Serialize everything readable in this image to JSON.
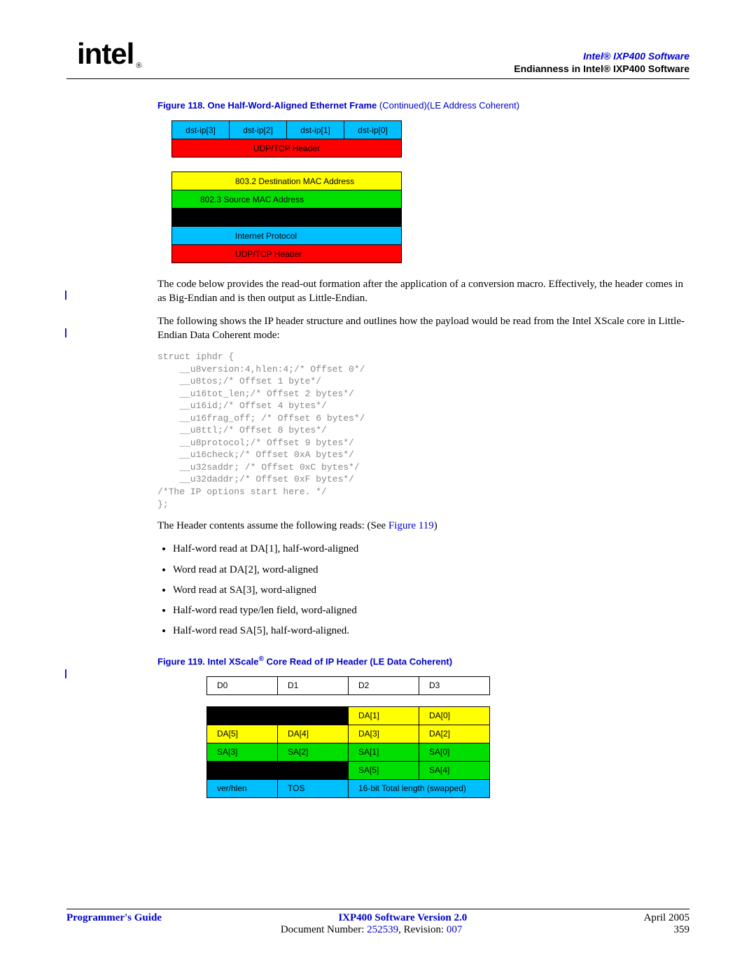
{
  "header": {
    "logo_text": "intel",
    "reg": "®",
    "line1": "Intel® IXP400 Software",
    "line2": "Endianness in Intel® IXP400 Software"
  },
  "fig118": {
    "caption_bold": "Figure 118. One Half-Word-Aligned Ethernet Frame ",
    "caption_plain": "(Continued)(LE Address Coherent)",
    "rowA": [
      "dst-ip[3]",
      "dst-ip[2]",
      "dst-ip[1]",
      "dst-ip[0]"
    ],
    "rowB": "UDP/TCP Header",
    "rowC": "803.2 Destination MAC Address",
    "rowD": "802.3 Source MAC Address",
    "rowE": "Internet Protocol",
    "rowF": "UDP/TCP Header"
  },
  "para1": "The code below provides the read-out formation after the application of a conversion macro. Effectively, the header comes in as Big-Endian and is then output as Little-Endian.",
  "para2": "The following shows the IP header structure and outlines how the payload would be read from the Intel XScale core in Little-Endian Data Coherent mode:",
  "code": "struct iphdr {\n    __u8version:4,hlen:4;/* Offset 0*/\n    __u8tos;/* Offset 1 byte*/\n    __u16tot_len;/* Offset 2 bytes*/\n    __u16id;/* Offset 4 bytes*/\n    __u16frag_off; /* Offset 6 bytes*/\n    __u8ttl;/* Offset 8 bytes*/\n    __u8protocol;/* Offset 9 bytes*/\n    __u16check;/* Offset 0xA bytes*/\n    __u32saddr; /* Offset 0xC bytes*/\n    __u32daddr;/* Offset 0xF bytes*/\n/*The IP options start here. */\n};",
  "para3_pre": "The Header contents assume the following reads: (See ",
  "para3_link": "Figure 119",
  "para3_post": ")",
  "bullets": [
    "Half-word read at DA[1], half-word-aligned",
    "Word read at DA[2], word-aligned",
    "Word read at SA[3], word-aligned",
    "Half-word read type/len field, word-aligned",
    "Half-word read SA[5], half-word-aligned."
  ],
  "fig119": {
    "caption": "Figure 119. Intel XScale® Core Read of IP Header (LE Data Coherent)",
    "hdr": [
      "D0",
      "D1",
      "D2",
      "D3"
    ],
    "r1": [
      "DA[1]",
      "DA[0]"
    ],
    "r2": [
      "DA[5]",
      "DA[4]",
      "DA[3]",
      "DA[2]"
    ],
    "r3": [
      "SA[3]",
      "SA[2]",
      "SA[1]",
      "SA[0]"
    ],
    "r4": [
      "SA[5]",
      "SA[4]"
    ],
    "r5": [
      "ver/hlen",
      "TOS",
      "16-bit Total length (swapped)"
    ]
  },
  "footer": {
    "left": "Programmer's Guide",
    "center": "IXP400 Software Version 2.0",
    "right_date": "April 2005",
    "doc_pre": "Document Number: ",
    "doc_num": "252539",
    "doc_mid": ", Revision: ",
    "doc_rev": "007",
    "page": "359"
  }
}
